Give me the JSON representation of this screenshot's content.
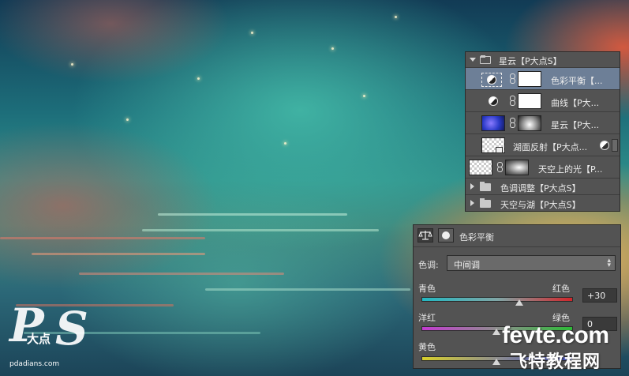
{
  "layers_panel": {
    "rows": [
      {
        "label": "星云【P大点S】",
        "type": "group-open"
      },
      {
        "label": "色彩平衡【...",
        "type": "adjustment",
        "selected": true
      },
      {
        "label": "曲线【P大...",
        "type": "adjustment"
      },
      {
        "label": "星云【P大...",
        "type": "image"
      },
      {
        "label": "湖面反射【P大点...",
        "type": "smart-object"
      },
      {
        "label": "天空上的光【P...",
        "type": "image"
      },
      {
        "label": "色调调整【P大点S】",
        "type": "group-closed"
      },
      {
        "label": "天空与湖【P大点S】",
        "type": "group-closed"
      }
    ]
  },
  "properties_panel": {
    "title": "色彩平衡",
    "tone_label": "色调:",
    "tone_value": "中间调",
    "sliders": [
      {
        "left": "青色",
        "right": "红色",
        "value": "+30",
        "level": 30
      },
      {
        "left": "洋红",
        "right": "绿色",
        "value": "0",
        "level": 0
      },
      {
        "left": "黄色",
        "right": "",
        "value": "",
        "level": 0
      }
    ]
  },
  "watermarks": {
    "ps_logo_letters": "PS",
    "ps_logo_cn": "大点",
    "ps_url": "pdadians.com",
    "site_en": "fevte.com",
    "site_cn": "飞特教程网"
  },
  "colors": {
    "panel_bg": "#535353",
    "selected_row": "#6d7f97",
    "cyan_red_track": [
      "#23b8c2",
      "#d2262b"
    ],
    "magenta_green_track": [
      "#c43bd1",
      "#2dbb37"
    ],
    "yellow_blue_track": [
      "#d8d02b",
      "#3a49c9"
    ]
  },
  "icons": {
    "folder": "folder-icon",
    "adjustment": "half-circle-adjustment-icon",
    "link": "chain-link-icon",
    "balance": "balance-scale-icon",
    "mask": "layer-mask-icon"
  }
}
